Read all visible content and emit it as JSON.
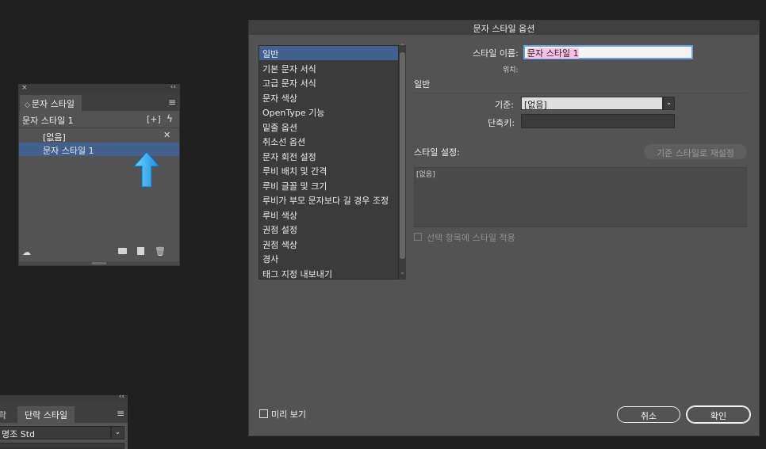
{
  "char_styles_panel": {
    "close_glyph": "×",
    "collapse_glyph": "‹‹",
    "tab_label": "문자 스타일",
    "tab_chevron": "◇",
    "menu_glyph": "≡",
    "current_style": "문자 스타일 1",
    "items": [
      {
        "label": "[없음]"
      },
      {
        "label": "문자 스타일 1"
      }
    ],
    "icons": [
      "new-group-icon",
      "quick-apply-icon",
      "clear-override-icon",
      "cloud-library-icon",
      "folder-icon",
      "new-style-icon",
      "trash-icon"
    ]
  },
  "para_styles_panel": {
    "collapse_glyph": "‹‹",
    "tab1_label": "락",
    "tab2_label": "단락 스타일",
    "menu_glyph": "≡",
    "font_value": "명조 Std"
  },
  "annotation": {
    "arrow_color": "#2ea8f0"
  },
  "dialog": {
    "title": "문자 스타일 옵션",
    "categories": [
      "일반",
      "기본 문자 서식",
      "고급 문자 서식",
      "문자 색상",
      "OpenType 기능",
      "밑줄 옵션",
      "취소선 옵션",
      "문자 회전 설정",
      "루비 배치 및 간격",
      "루비 글꼴 및 크기",
      "루비가 부모 문자보다 길 경우 조정",
      "루비 색상",
      "권점 설정",
      "권점 색상",
      "경사",
      "태그 지정 내보내기"
    ],
    "selected_category": "일반",
    "style_name_label": "스타일 이름:",
    "style_name_value": "문자 스타일 1",
    "location_label": "위치:",
    "general_header": "일반",
    "based_on_label": "기준:",
    "based_on_value": "[없음]",
    "shortcut_label": "단축키:",
    "shortcut_value": "",
    "style_settings_label": "스타일 설정:",
    "reset_button": "기준 스타일로 재설정",
    "style_settings_text": "[없음]",
    "apply_to_selection_label": "선택 항목에 스타일 적용",
    "preview_label": "미리 보기",
    "cancel_button": "취소",
    "ok_button": "확인",
    "accent_color": "#44608c"
  }
}
